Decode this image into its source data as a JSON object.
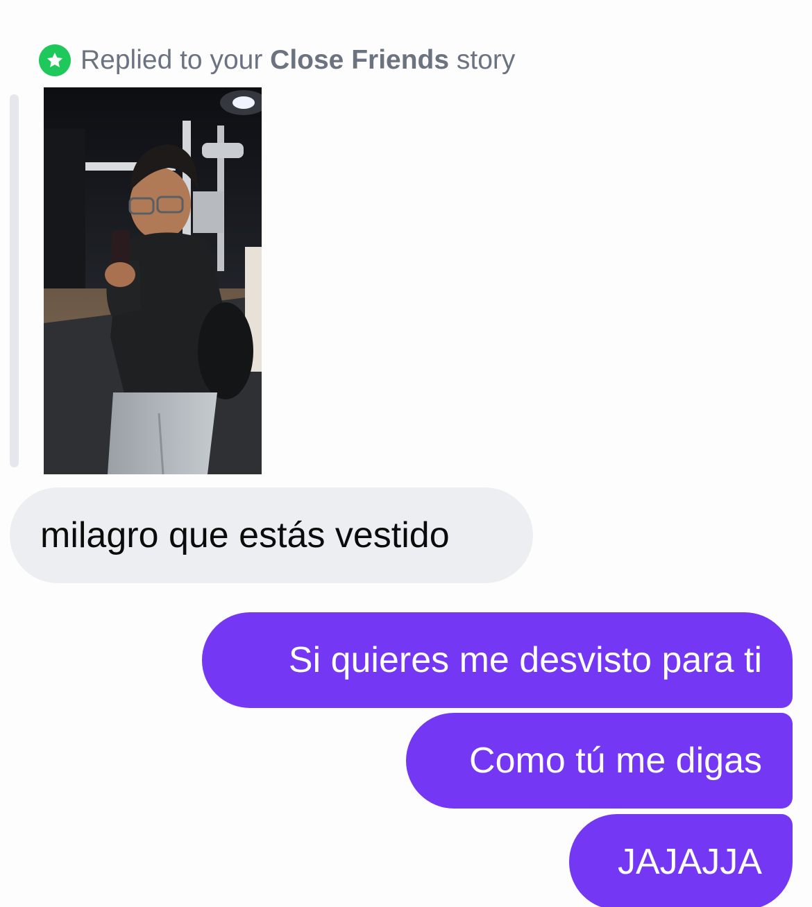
{
  "reply_header": {
    "prefix": "Replied to your ",
    "highlight": "Close Friends",
    "suffix": " story",
    "icon": "star-icon",
    "badge_color": "#1ec85a"
  },
  "story": {
    "preview": "mirror-selfie-photo"
  },
  "messages": [
    {
      "direction": "incoming",
      "text": "milagro que estás vestido"
    },
    {
      "direction": "outgoing",
      "text": "Si quieres me desvisto para ti"
    },
    {
      "direction": "outgoing",
      "text": "Como tú me digas"
    },
    {
      "direction": "outgoing",
      "text": "JAJAJJA"
    }
  ],
  "colors": {
    "incoming_bubble": "#eceef1",
    "outgoing_bubble": "#7437f4",
    "background": "#fdfdfe"
  }
}
